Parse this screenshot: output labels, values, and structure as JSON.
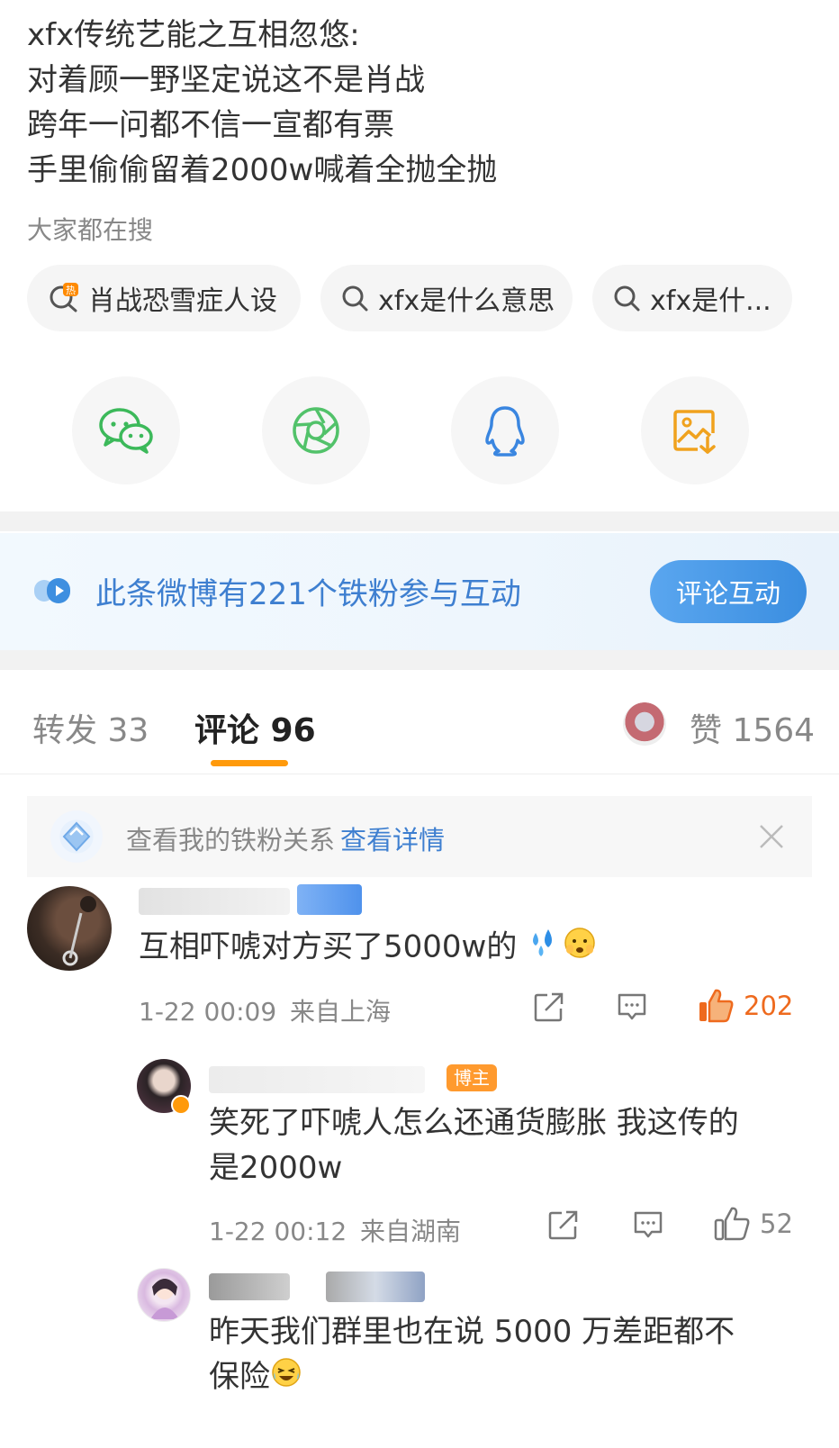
{
  "post": {
    "lines": [
      "xfx传统艺能之互相忽悠:",
      "对着顾一野坚定说这不是肖战",
      "跨年一问都不信一宣都有票",
      "手里偷偷留着2000w喊着全抛全抛"
    ]
  },
  "search": {
    "title": "大家都在搜",
    "chips": [
      "肖战恐雪症人设",
      "xfx是什么意思",
      "xfx是什..."
    ]
  },
  "share": {
    "icons": [
      "wechat-icon",
      "moments-icon",
      "qq-icon",
      "save-image-icon"
    ],
    "colors": [
      "#3cb95a",
      "#52c26a",
      "#3a86e0",
      "#f0a21e"
    ]
  },
  "fans_banner": {
    "text": "此条微博有221个铁粉参与互动",
    "button": "评论互动"
  },
  "tabs": {
    "repost": "转发 33",
    "comment": "评论 96",
    "like": "赞 1564"
  },
  "fans_relation": {
    "text": "查看我的铁粉关系",
    "link": "查看详情"
  },
  "comments": [
    {
      "text": "互相吓唬对方买了5000w的",
      "time": "1-22 00:09",
      "location": "来自上海",
      "likes": "202",
      "liked": true
    },
    {
      "badge": "博主",
      "text_line1": "笑死了吓唬人怎么还通货膨胀 我这传的",
      "text_line2": "是2000w",
      "time": "1-22 00:12",
      "location": "来自湖南",
      "likes": "52",
      "liked": false
    },
    {
      "text_line1": "昨天我们群里也在说 5000 万差距都不",
      "text_line2": "保险"
    }
  ],
  "colors": {
    "accent_orange": "#ff9a0b",
    "link_blue": "#3e7fd0",
    "liked_orange": "#ee6a1e"
  }
}
